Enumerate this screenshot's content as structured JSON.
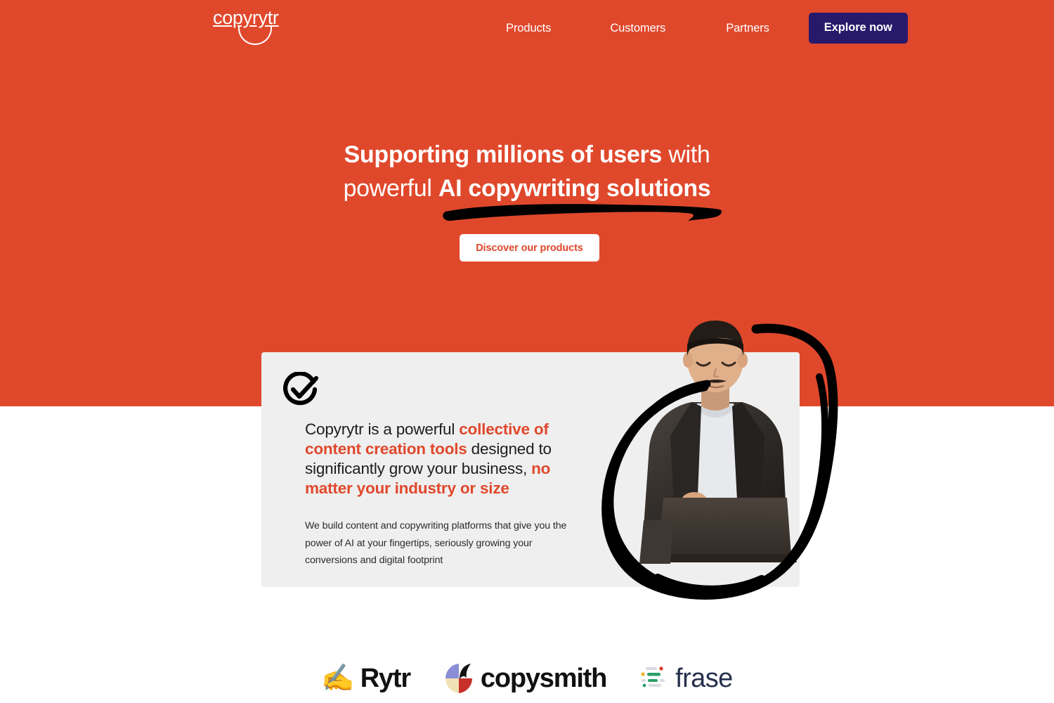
{
  "brand": {
    "logo_text": "copyrytr",
    "colors": {
      "hero_orange": "#e0482c",
      "navy": "#281a6b",
      "card_gray": "#efefef",
      "ink": "#1d1d1d"
    }
  },
  "header": {
    "nav": [
      {
        "label": "Products",
        "name": "nav-link-products"
      },
      {
        "label": "Customers",
        "name": "nav-link-customers"
      },
      {
        "label": "Partners",
        "name": "nav-link-partners"
      }
    ],
    "cta_label": "Explore now"
  },
  "hero": {
    "title_part_1": "Supporting millions of users",
    "title_part_2": " with powerful ",
    "title_part_3": "AI copywriting solutions",
    "cta_label": "Discover our products"
  },
  "feature_card": {
    "icon": "check-circle-icon",
    "heading_1": "Copyrytr is a powerful ",
    "heading_highlight_1": "collective of content creation tools",
    "heading_2": " designed to significantly grow your business, ",
    "heading_highlight_2": "no matter your industry or size",
    "body": "We build content and copywriting platforms that give you the power of AI at your fingertips, seriously growing your conversions and digital footprint",
    "image_alt": "man-working-on-laptop-photo"
  },
  "partners": [
    {
      "name": "Rytr",
      "icon": "writing-hand-emoji",
      "glyph": "✍️"
    },
    {
      "name": "copysmith",
      "icon": "copysmith-mark"
    },
    {
      "name": "frase",
      "icon": "frase-mark"
    }
  ]
}
